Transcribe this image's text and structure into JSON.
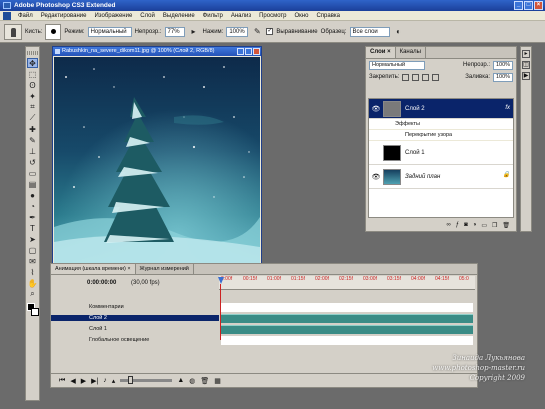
{
  "window": {
    "title": "Adobe Photoshop CS3 Extended",
    "controls": [
      "minimize-icon",
      "maximize-icon",
      "close-icon"
    ]
  },
  "menu": [
    "Файл",
    "Редактирование",
    "Изображение",
    "Слой",
    "Выделение",
    "Фильтр",
    "Анализ",
    "Просмотр",
    "Окно",
    "Справка"
  ],
  "options": {
    "brush_label": "Кисть:",
    "brush_size": "9",
    "mode_label": "Режим:",
    "mode_value": "Нормальный",
    "opacity_label": "Непрозр.:",
    "opacity_value": "77%",
    "flow_label": "Нажим:",
    "flow_value": "100%",
    "align_label": "Выравнивание",
    "sample_label": "Образец:",
    "sample_value": "Все слои"
  },
  "toolbox": {
    "icons": [
      "move-icon",
      "marquee-icon",
      "lasso-icon",
      "magic-wand-icon",
      "crop-icon",
      "slice-icon",
      "healing-icon",
      "brush-icon",
      "clone-stamp-icon",
      "history-brush-icon",
      "eraser-icon",
      "gradient-icon",
      "blur-icon",
      "dodge-icon",
      "pen-icon",
      "type-icon",
      "path-select-icon",
      "shape-icon",
      "notes-icon",
      "eyedropper-icon",
      "hand-icon",
      "zoom-icon"
    ],
    "colors": {
      "foreground": "#000000",
      "background": "#ffffff"
    }
  },
  "document": {
    "title": "Rabushkin_na_severe_dikom11.jpg @ 100% (Слой 2, RGB/8)"
  },
  "layers_panel": {
    "tabs": [
      "Слои ×",
      "Каналы"
    ],
    "blend_mode": "Нормальный",
    "opacity_label": "Непрозр.:",
    "opacity_value": "100%",
    "lock_label": "Закрепить:",
    "fill_label": "Заливка:",
    "fill_value": "100%",
    "layers": [
      {
        "name": "Слой 2",
        "selected": true,
        "visible": true,
        "fx": true,
        "thumb": "gray"
      },
      {
        "name": "Эффекты",
        "sub": true
      },
      {
        "name": "Перекрытие узора",
        "sub": true
      },
      {
        "name": "Слой 1",
        "selected": false,
        "visible": false,
        "fx": false,
        "thumb": "black"
      },
      {
        "name": "Задний план",
        "selected": false,
        "visible": true,
        "fx": false,
        "thumb": "img",
        "locked": true
      }
    ],
    "fx_symbol": "fx"
  },
  "animation_panel": {
    "tabs": [
      "Анимация (шкала времени) ×",
      "Журнал измерений"
    ],
    "timecode": "0:00:00:00",
    "fps": "(30,00 fps)",
    "ruler_ticks": [
      "0:00f",
      "00:15f",
      "01:00f",
      "01:15f",
      "02:00f",
      "02:15f",
      "03:00f",
      "03:15f",
      "04:00f",
      "04:15f",
      "05:0"
    ],
    "tracks": [
      {
        "name": "Комментарии",
        "selected": false,
        "bar": "white"
      },
      {
        "name": "Слой 2",
        "selected": true,
        "bar": "teal"
      },
      {
        "name": "Слой 1",
        "selected": false,
        "bar": "teal"
      },
      {
        "name": "Глобальное освещение",
        "selected": false,
        "bar": "white"
      }
    ]
  },
  "watermark": {
    "line1": "Зинаида Лукьянова",
    "line2": "www.photoshop-master.ru",
    "line3": "Copyright 2009"
  }
}
